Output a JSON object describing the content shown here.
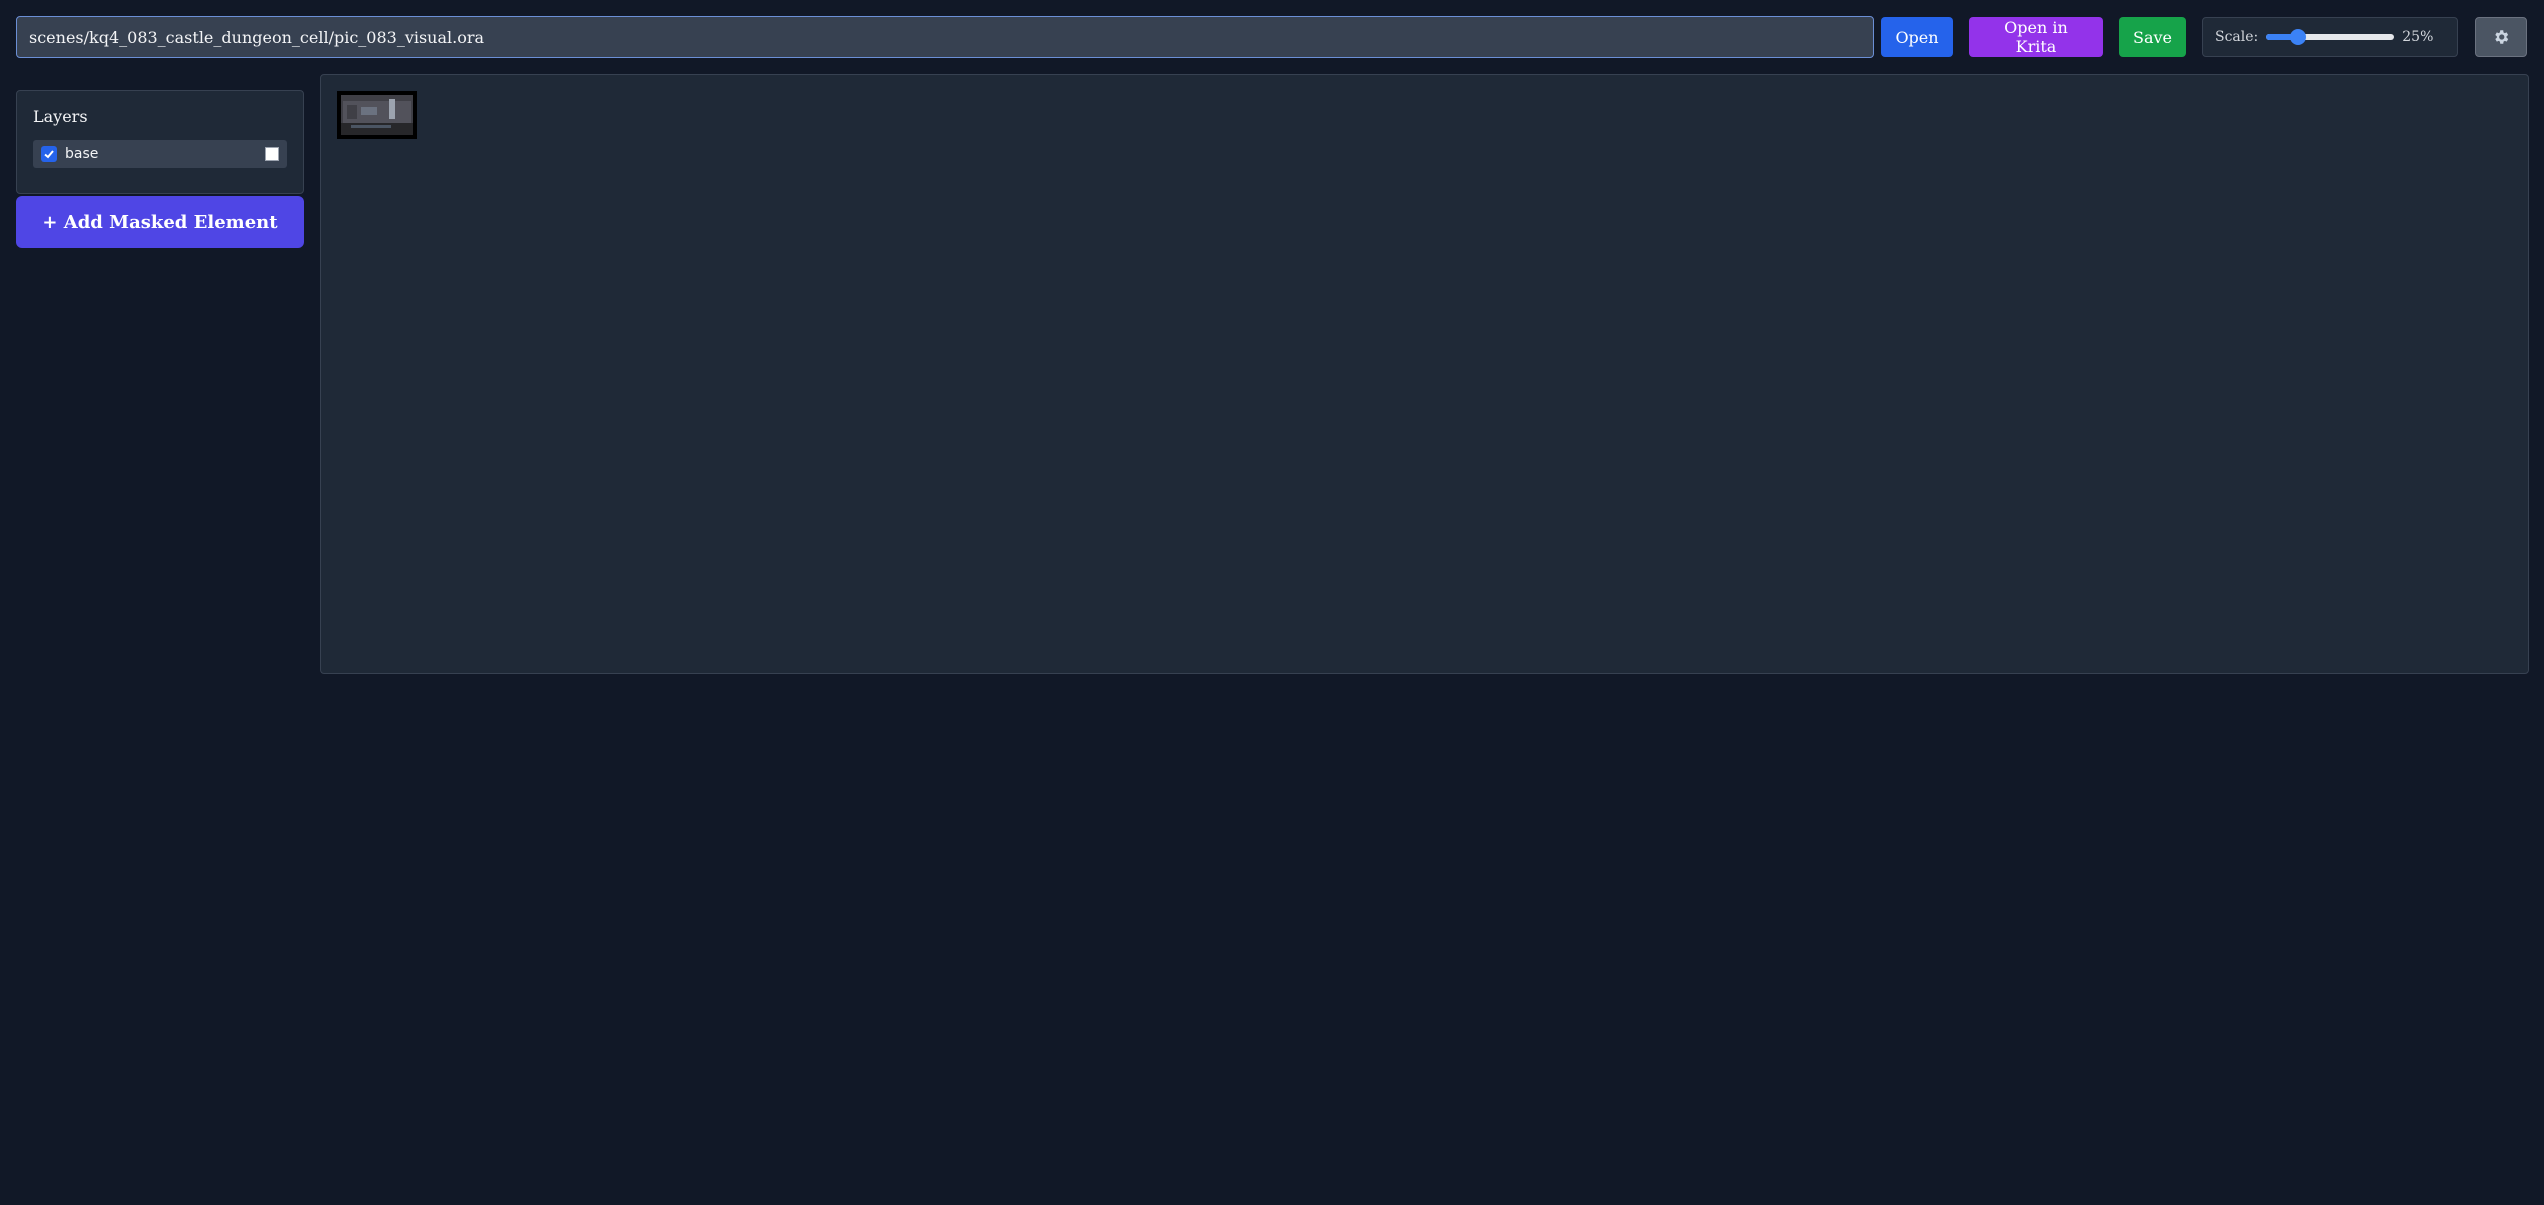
{
  "toolbar": {
    "path_value": "scenes/kq4_083_castle_dungeon_cell/pic_083_visual.ora",
    "open_label": "Open",
    "open_krita_label": "Open in Krita",
    "save_label": "Save",
    "scale_label": "Scale:",
    "scale_value": 25,
    "scale_text": "25%",
    "settings_icon": "gear-icon"
  },
  "sidebar": {
    "layers_title": "Layers",
    "layers": [
      {
        "name": "base",
        "visible": true,
        "color": "#ffffff"
      }
    ],
    "add_button_label": "+ Add Masked Element"
  },
  "colors": {
    "background": "#111827",
    "panel": "#1f2937",
    "open": "#2563eb",
    "krita": "#9333ea",
    "save": "#16a34a",
    "add": "#4f46e5"
  }
}
